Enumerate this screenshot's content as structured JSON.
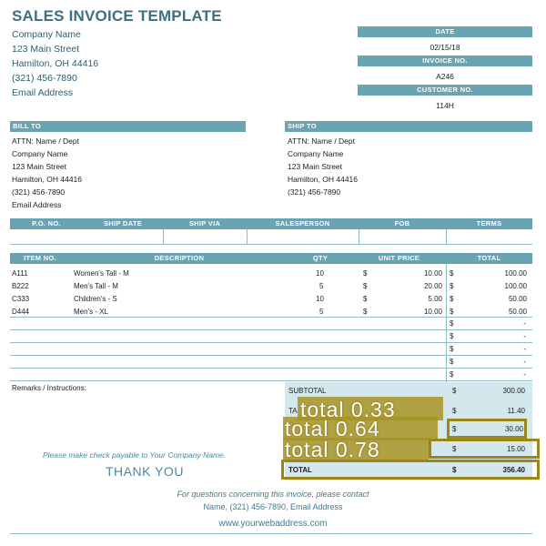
{
  "title": "SALES INVOICE TEMPLATE",
  "company": {
    "name": "Company Name",
    "street": "123 Main Street",
    "city": "Hamilton, OH  44416",
    "phone": "(321) 456-7890",
    "email": "Email Address"
  },
  "meta": {
    "date_label": "DATE",
    "date_value": "02/15/18",
    "invoice_label": "INVOICE NO.",
    "invoice_value": "A246",
    "customer_label": "CUSTOMER NO.",
    "customer_value": "114H"
  },
  "bill_to": {
    "label": "BILL TO",
    "attn": "ATTN: Name / Dept",
    "company": "Company Name",
    "street": "123 Main Street",
    "city": "Hamilton, OH  44416",
    "phone": "(321) 456-7890",
    "email": "Email Address"
  },
  "ship_to": {
    "label": "SHIP TO",
    "attn": "ATTN: Name / Dept",
    "company": "Company Name",
    "street": "123 Main Street",
    "city": "Hamilton, OH  44416",
    "phone": "(321) 456-7890"
  },
  "order_headers": [
    "P.O. NO.",
    "SHIP DATE",
    "SHIP VIA",
    "SALESPERSON",
    "FOB",
    "TERMS"
  ],
  "item_headers": [
    "ITEM NO.",
    "DESCRIPTION",
    "QTY",
    "UNIT PRICE",
    "TOTAL"
  ],
  "items": [
    {
      "no": "A111",
      "desc": "Women's Tall - M",
      "qty": "10",
      "cur": "$",
      "price": "10.00",
      "tcur": "$",
      "total": "100.00"
    },
    {
      "no": "B222",
      "desc": "Men's Tall - M",
      "qty": "5",
      "cur": "$",
      "price": "20.00",
      "tcur": "$",
      "total": "100.00"
    },
    {
      "no": "C333",
      "desc": "Children's - S",
      "qty": "10",
      "cur": "$",
      "price": "5.00",
      "tcur": "$",
      "total": "50.00"
    },
    {
      "no": "D444",
      "desc": "Men's - XL",
      "qty": "5",
      "cur": "$",
      "price": "10.00",
      "tcur": "$",
      "total": "50.00"
    }
  ],
  "empty_rows": [
    {
      "cur": "$",
      "total": "-"
    },
    {
      "cur": "$",
      "total": "-"
    },
    {
      "cur": "$",
      "total": "-"
    },
    {
      "cur": "$",
      "total": "-"
    },
    {
      "cur": "$",
      "total": "-"
    }
  ],
  "remarks": "Remarks / Instructions:",
  "totals": {
    "subtotal_label": "SUBTOTAL",
    "subtotal_cur": "$",
    "subtotal_value": "300.00",
    "tax_label": "TA",
    "tax_cur": "$",
    "tax_value": "11.40",
    "row3_cur": "$",
    "row3_value": "30.00",
    "row4_cur": "$",
    "row4_value": "15.00",
    "total_label": "TOTAL",
    "total_cur": "$",
    "total_value": "356.40"
  },
  "note": "Please make check payable to Your Company Name.",
  "thanks": "THANK YOU",
  "footer": {
    "line1": "For questions concerning this invoice, please contact",
    "line2": "Name, (321) 456-7890, Email Address",
    "web": "www.yourwebaddress.com"
  },
  "overlays": [
    {
      "label": "total 0.33"
    },
    {
      "label": "total 0.64"
    },
    {
      "label": "total 0.78"
    }
  ],
  "colors": {
    "accent": "#6aa3b2",
    "title": "#3f6f82",
    "box": "#9b8718"
  }
}
